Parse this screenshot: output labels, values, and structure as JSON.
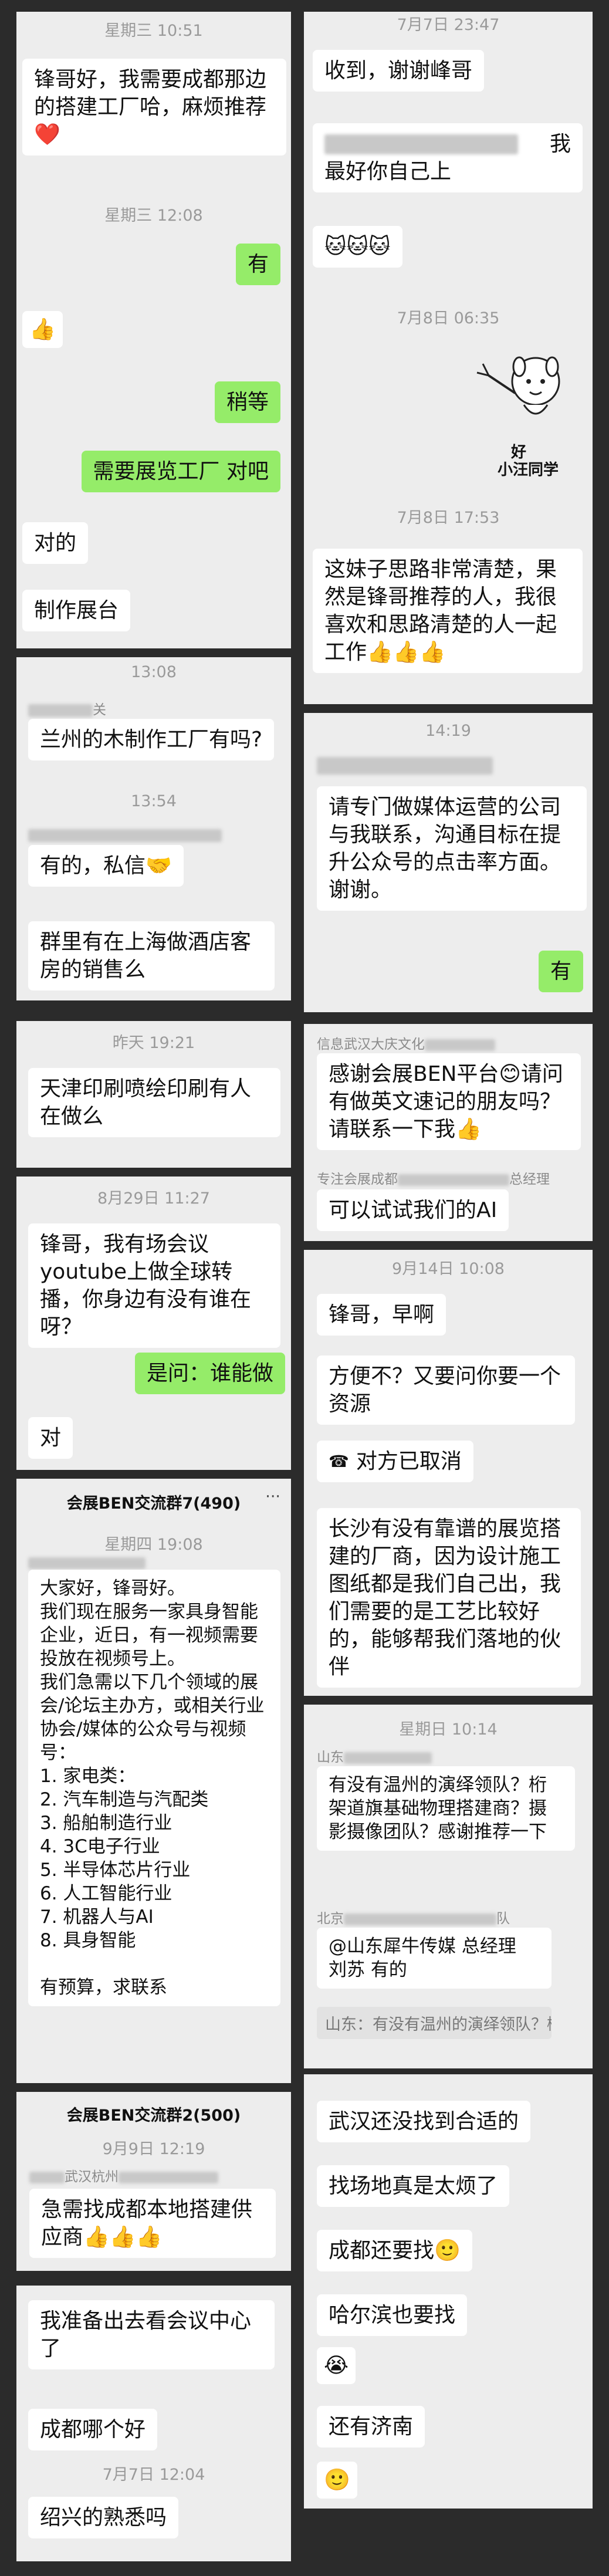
{
  "p1": {
    "ts1": "星期三 10:51",
    "b1": "锋哥好，我需要成都那边的搭建工厂哈，麻烦推荐",
    "b1_emoji": "❤️",
    "ts2": "星期三 12:08",
    "b2": "有",
    "b3": "👍",
    "b4": "稍等",
    "b5": "需要展览工厂 对吧",
    "b6": "对的",
    "b7": "制作展台"
  },
  "p2": {
    "ts1": "7月7日 23:47",
    "b1": "收到，谢谢峰哥",
    "b2_end": "我",
    "b2_line2": "最好你自己上",
    "b3": "🐱🐱🐱",
    "ts2": "7月8日 06:35",
    "sticker_t1": "好",
    "sticker_t2": "小汪同学",
    "ts3": "7月8日 17:53",
    "b4": "这妹子思路非常清楚，果然是锋哥推荐的人，我很喜欢和思路清楚的人一起工作👍👍👍"
  },
  "p3": {
    "ts1": "13:08",
    "sender1_tail": "关",
    "b1": "兰州的木制作工厂有吗?",
    "ts2": "13:54",
    "b2": "有的，私信🤝",
    "b3": "群里有在上海做酒店客房的销售么"
  },
  "p4": {
    "ts1": "14:19",
    "b1": "请专门做媒体运营的公司与我联系，沟通目标在提升公众号的点击率方面。谢谢。",
    "b2": "有"
  },
  "p5": {
    "ts1": "昨天 19:21",
    "b1": "天津印刷喷绘印刷有人在做么"
  },
  "p6": {
    "sender1": "信息武汉大庆文化",
    "b1": "感谢会展BEN平台😊请问有做英文速记的朋友吗？请联系一下我👍",
    "sender2_head": "专注会展成都",
    "sender2_tail": "总经理",
    "b2": "可以试试我们的AI"
  },
  "p7": {
    "ts1": "8月29日 11:27",
    "b1": "锋哥，我有场会议youtube上做全球转播，你身边有没有谁在呀？",
    "b2": "是问：谁能做",
    "b3": "对"
  },
  "p8": {
    "ts1": "9月14日 10:08",
    "b1": "锋哥，早啊",
    "b2": "方便不？又要问你要一个资源",
    "b3": "对方已取消",
    "b4": "长沙有没有靠谱的展览搭建的厂商，因为设计施工图纸都是我们自己出，我们需要的是工艺比较好的，能够帮我们落地的伙伴"
  },
  "p9": {
    "title": "会展BEN交流群7(490)",
    "ts1": "星期四 19:08",
    "b1_lines": [
      "大家好，锋哥好。",
      "我们现在服务一家具身智能企业，近日，有一视频需要投放在视频号上。",
      "我们急需以下几个领域的展会/论坛主办方，或相关行业协会/媒体的公众号与视频号：",
      "1. 家电类：",
      "2. 汽车制造与汽配类",
      "3. 船舶制造行业",
      "4. 3C电子行业",
      "5. 半导体芯片行业",
      "6. 人工智能行业",
      "7. 机器人与AI",
      "8. 具身智能",
      "",
      "有预算，求联系"
    ]
  },
  "p10": {
    "ts1": "星期日 10:14",
    "sender1": "山东",
    "b1": "有没有温州的演绎领队？桁架道旗基础物理搭建商？摄影摄像团队？感谢推荐一下",
    "sender2": "北京",
    "sender2_tail": "队",
    "b2": "@山东犀牛传媒 总经理 刘苏 有的",
    "quote": "山东：有没有温州的演绎领队？桁架道旗基础..."
  },
  "p11": {
    "title": "会展BEN交流群2(500)",
    "ts1": "9月9日 12:19",
    "sender1": "武汉杭州",
    "b1": "急需找成都本地搭建供应商👍👍👍"
  },
  "p12": {
    "b1": "我准备出去看会议中心了",
    "b2": "成都哪个好",
    "ts1": "7月7日 12:04",
    "b3": "绍兴的熟悉吗"
  },
  "p13": {
    "b1": "武汉还没找到合适的",
    "b2": "找场地真是太烦了",
    "b3": "成都还要找🙂",
    "b4": "哈尔滨也要找",
    "b5": "😭",
    "b6": "还有济南",
    "b7": "🙂"
  }
}
